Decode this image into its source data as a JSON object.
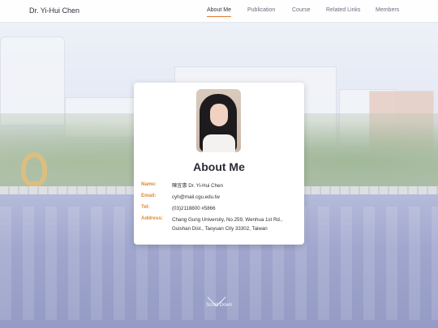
{
  "nav": {
    "brand": "Dr. Yi-Hui Chen",
    "items": [
      {
        "label": "About Me",
        "active": true
      },
      {
        "label": "Publication",
        "active": false
      },
      {
        "label": "Course",
        "active": false
      },
      {
        "label": "Related Links",
        "active": false
      },
      {
        "label": "Members",
        "active": false
      }
    ],
    "accent_color": "#e07d2e"
  },
  "profile": {
    "heading": "About Me",
    "fields": [
      {
        "key": "Name:",
        "value": "陳宜惠 Dr. Yi-Hui Chen"
      },
      {
        "key": "Email:",
        "value": "cyh@mail.cgu.edu.tw"
      },
      {
        "key": "Tel:",
        "value": "(03)2118800 #5866"
      },
      {
        "key": "Address:",
        "value": "Chang Gung University, No.259, Wenhua 1st Rd., Guishan Dist., Taoyuan City 33302, Taiwan"
      }
    ]
  },
  "scroll": {
    "label": "Scroll Down",
    "icon": "chevron-down-icon"
  }
}
